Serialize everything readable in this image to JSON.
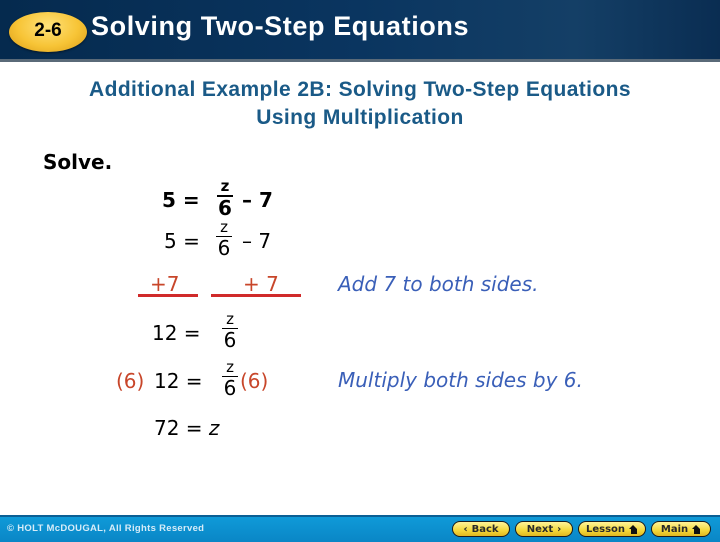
{
  "header": {
    "badge": "2-6",
    "title": "Solving Two-Step Equations"
  },
  "example": {
    "title_line1": "Additional Example 2B: Solving Two-Step Equations",
    "title_line2": "Using Multiplication"
  },
  "solve_label": "Solve.",
  "steps": {
    "bold_eq": {
      "left": "5 =",
      "num": "z",
      "den": "6",
      "right": "– 7"
    },
    "eq1": {
      "left": "5 =",
      "num": "z",
      "den": "6",
      "right": "– 7"
    },
    "add_left": "+7",
    "add_right": "+ 7",
    "eq2": {
      "left": "12 =",
      "num": "z",
      "den": "6"
    },
    "eq3": {
      "left_paren": "(6)",
      "left": "12 =",
      "num": "z",
      "den": "6",
      "right_paren": "(6)"
    },
    "eq4": {
      "text": "72 = ",
      "var": "z"
    }
  },
  "notes": {
    "add": "Add 7 to both sides.",
    "multiply": "Multiply both sides by 6."
  },
  "footer": {
    "copyright": "© HOLT McDOUGAL, All Rights Reserved",
    "buttons": {
      "back": {
        "label": "Back",
        "icon": "chevron-left"
      },
      "next": {
        "label": "Next",
        "icon": "chevron-right"
      },
      "lesson": {
        "label": "Lesson",
        "icon": "home"
      },
      "main": {
        "label": "Main",
        "icon": "home"
      }
    }
  },
  "colors": {
    "header_bg": "#0a3560",
    "badge": "#f7c436",
    "example_title": "#1a5a87",
    "operation_red": "#c8462a",
    "note_blue": "#3a5fb8",
    "footer_bg": "#0a86c6"
  }
}
